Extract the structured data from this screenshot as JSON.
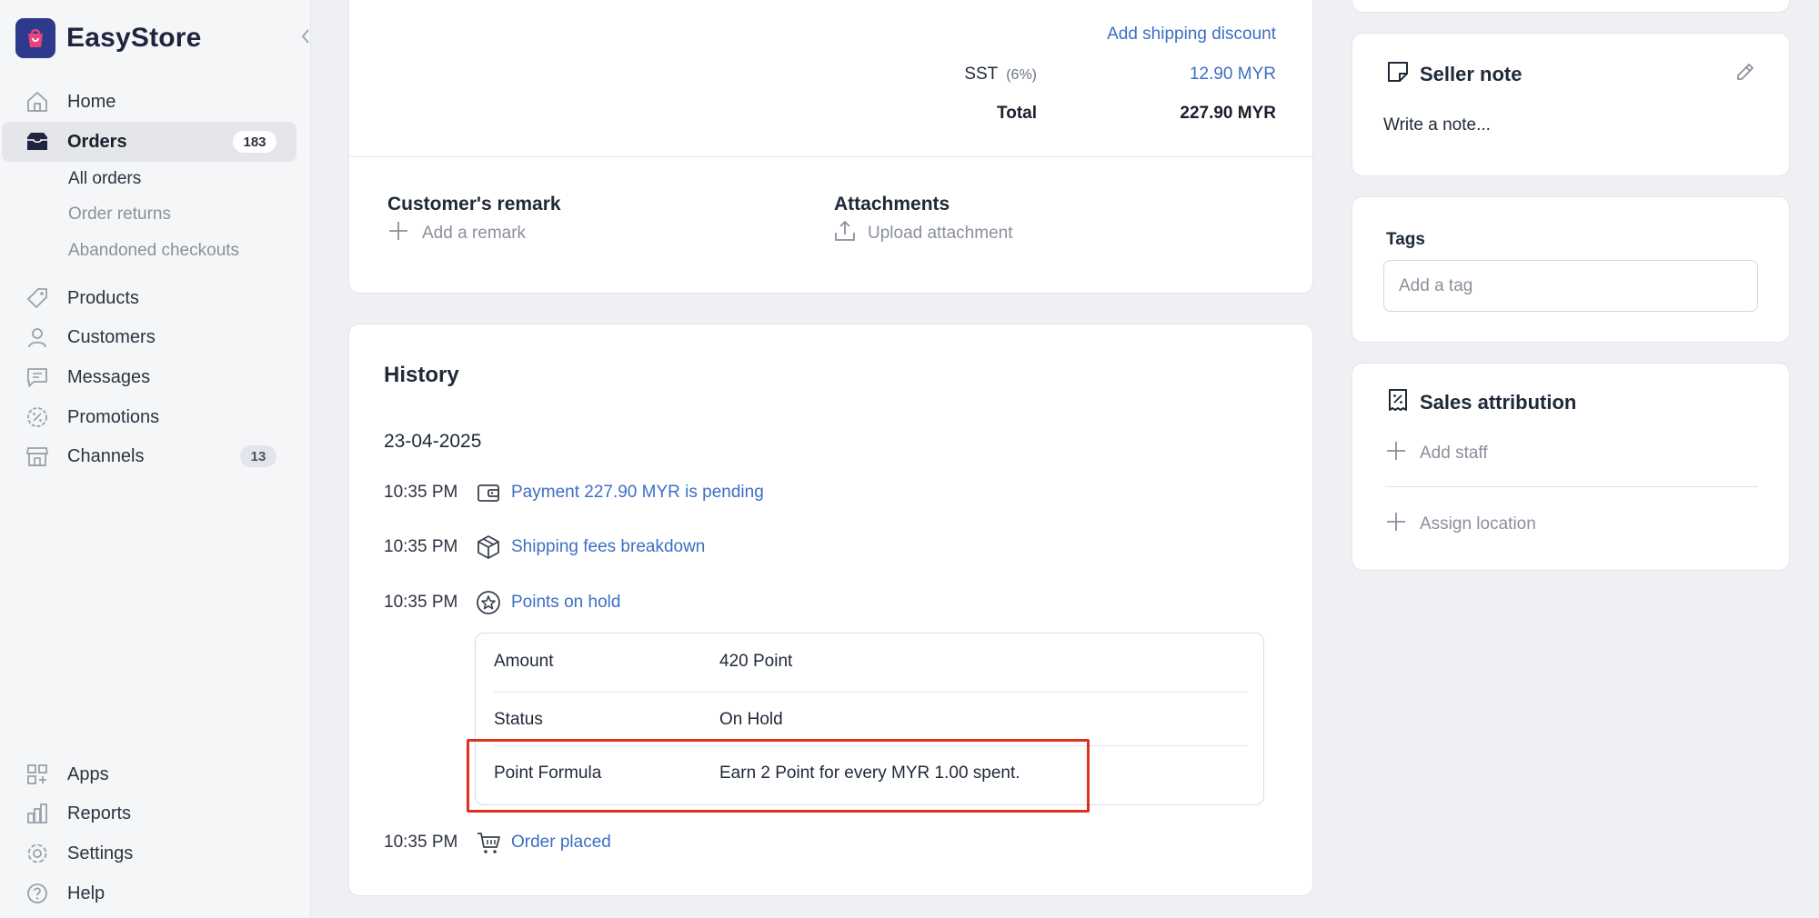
{
  "app": {
    "name": "EasyStore"
  },
  "sidebar": {
    "items": [
      {
        "label": "Home"
      },
      {
        "label": "Orders",
        "badge": "183"
      },
      {
        "label": "Products"
      },
      {
        "label": "Customers"
      },
      {
        "label": "Messages"
      },
      {
        "label": "Promotions"
      },
      {
        "label": "Channels",
        "badge": "13"
      }
    ],
    "orders_sub": [
      {
        "label": "All orders"
      },
      {
        "label": "Order returns"
      },
      {
        "label": "Abandoned checkouts"
      }
    ],
    "bottom_items": [
      {
        "label": "Apps"
      },
      {
        "label": "Reports"
      },
      {
        "label": "Settings"
      },
      {
        "label": "Help"
      }
    ]
  },
  "summary": {
    "add_shipping_discount": "Add shipping discount",
    "tax_label": "SST",
    "tax_rate": "(6%)",
    "tax_value": "12.90 MYR",
    "total_label": "Total",
    "total_value": "227.90 MYR"
  },
  "remark": {
    "title": "Customer's remark",
    "add_label": "Add a remark",
    "attachments_title": "Attachments",
    "upload_label": "Upload attachment"
  },
  "history": {
    "title": "History",
    "date": "23-04-2025",
    "events": [
      {
        "time": "10:35 PM",
        "label": "Payment 227.90 MYR is pending",
        "icon": "wallet-icon"
      },
      {
        "time": "10:35 PM",
        "label": "Shipping fees breakdown",
        "icon": "package-icon"
      },
      {
        "time": "10:35 PM",
        "label": "Points on hold",
        "icon": "star-badge-icon"
      },
      {
        "time": "10:35 PM",
        "label": "Order placed",
        "icon": "cart-icon"
      }
    ],
    "points_detail": [
      {
        "key": "Amount",
        "value": "420 Point"
      },
      {
        "key": "Status",
        "value": "On Hold"
      },
      {
        "key": "Point Formula",
        "value": "Earn 2 Point for every MYR 1.00 spent."
      }
    ]
  },
  "seller_note": {
    "title": "Seller note",
    "placeholder": "Write a note..."
  },
  "tags": {
    "title": "Tags",
    "placeholder": "Add a tag"
  },
  "sales_attribution": {
    "title": "Sales attribution",
    "add_staff": "Add staff",
    "assign_location": "Assign location"
  },
  "colors": {
    "accent_link": "#3d6fc4",
    "highlight_border": "#e0301e",
    "brand_logo_bg": "#2e3a8c",
    "brand_logo_fg": "#e8457a"
  }
}
